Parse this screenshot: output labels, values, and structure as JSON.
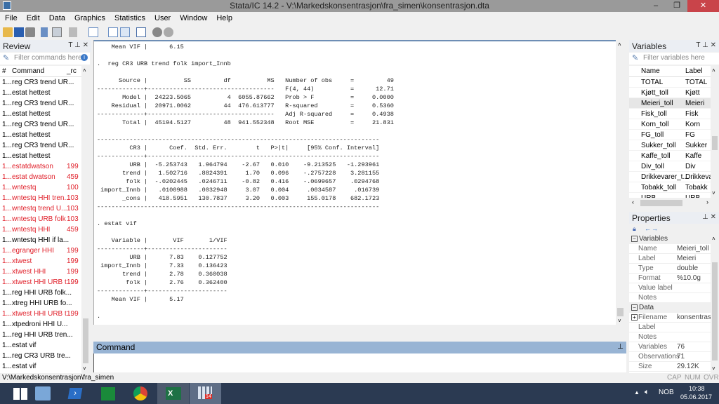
{
  "window": {
    "title": "Stata/IC 14.2 - V:\\Markedskonsentrasjon\\fra_simen\\konsentrasjon.dta",
    "minimize": "–",
    "restore": "❐",
    "close": "✕"
  },
  "menu": [
    "File",
    "Edit",
    "Data",
    "Graphics",
    "Statistics",
    "User",
    "Window",
    "Help"
  ],
  "toolbar_icons": [
    "open-icon",
    "save-icon",
    "print-icon",
    "log-icon",
    "viewer-icon",
    "graph-icon",
    "do-file-editor-icon",
    "data-editor-icon",
    "data-browser-icon",
    "variables-manager-icon",
    "more-icon",
    "break-icon"
  ],
  "review": {
    "title": "Review",
    "filter_placeholder": "Filter commands here",
    "col_num": "#",
    "col_command": "Command",
    "col_rc": "_rc",
    "items": [
      {
        "num": "1...",
        "cmd": "reg CR3 trend UR...",
        "rc": "",
        "error": false
      },
      {
        "num": "1...",
        "cmd": "estat hettest",
        "rc": "",
        "error": false
      },
      {
        "num": "1...",
        "cmd": "reg CR3 trend UR...",
        "rc": "",
        "error": false
      },
      {
        "num": "1...",
        "cmd": "estat hettest",
        "rc": "",
        "error": false
      },
      {
        "num": "1...",
        "cmd": "reg CR3 trend UR...",
        "rc": "",
        "error": false
      },
      {
        "num": "1...",
        "cmd": "estat hettest",
        "rc": "",
        "error": false
      },
      {
        "num": "1...",
        "cmd": "reg CR3 trend UR...",
        "rc": "",
        "error": false
      },
      {
        "num": "1...",
        "cmd": "estat hettest",
        "rc": "",
        "error": false
      },
      {
        "num": "1...",
        "cmd": "estatdwatson",
        "rc": "199",
        "error": true
      },
      {
        "num": "1...",
        "cmd": "estat dwatson",
        "rc": "459",
        "error": true
      },
      {
        "num": "1...",
        "cmd": "wntestq",
        "rc": "100",
        "error": true
      },
      {
        "num": "1...",
        "cmd": "wntestq HHI tren...",
        "rc": "103",
        "error": true
      },
      {
        "num": "1...",
        "cmd": " wntestq trend U...",
        "rc": "103",
        "error": true
      },
      {
        "num": "1...",
        "cmd": "wntestq URB folk",
        "rc": "103",
        "error": true
      },
      {
        "num": "1...",
        "cmd": " wntestq HHI",
        "rc": "459",
        "error": true
      },
      {
        "num": "1...",
        "cmd": "wntestq HHI if la...",
        "rc": "",
        "error": false
      },
      {
        "num": "1...",
        "cmd": "egranger HHI",
        "rc": "199",
        "error": true
      },
      {
        "num": "1...",
        "cmd": "xtwest",
        "rc": "199",
        "error": true
      },
      {
        "num": "1...",
        "cmd": "xtwest HHI",
        "rc": "199",
        "error": true
      },
      {
        "num": "1...",
        "cmd": "xtwest HHI URB t...",
        "rc": "199",
        "error": true
      },
      {
        "num": "1...",
        "cmd": "reg HHI URB folk...",
        "rc": "",
        "error": false
      },
      {
        "num": "1...",
        "cmd": "xtreg HHI URB fo...",
        "rc": "",
        "error": false
      },
      {
        "num": "1...",
        "cmd": "xtwest HHI URB t...",
        "rc": "199",
        "error": true
      },
      {
        "num": "1...",
        "cmd": "xtpedroni HHI U...",
        "rc": "",
        "error": false
      },
      {
        "num": "1...",
        "cmd": "reg HHI URB tren...",
        "rc": "",
        "error": false
      },
      {
        "num": "1...",
        "cmd": "estat vif",
        "rc": "",
        "error": false
      },
      {
        "num": "1...",
        "cmd": " reg CR3 URB tre...",
        "rc": "",
        "error": false
      },
      {
        "num": "1...",
        "cmd": "estat vif",
        "rc": "",
        "error": false
      }
    ]
  },
  "results": {
    "prev_meanvif_label": "Mean VIF",
    "prev_meanvif_value": "6.15",
    "reg_command": ".  reg CR3 URB trend folk import_Innb",
    "anova": {
      "headers": [
        "Source",
        "SS",
        "df",
        "MS"
      ],
      "rows": [
        {
          "source": "Model",
          "ss": "24223.5065",
          "df": "4",
          "ms": "6055.87662"
        },
        {
          "source": "Residual",
          "ss": "20971.0062",
          "df": "44",
          "ms": "476.613777"
        },
        {
          "source": "Total",
          "ss": "45194.5127",
          "df": "48",
          "ms": "941.552348"
        }
      ]
    },
    "stats": [
      {
        "label": "Number of obs",
        "value": "49"
      },
      {
        "label": "F(4, 44)",
        "value": "12.71"
      },
      {
        "label": "Prob > F",
        "value": "0.0000"
      },
      {
        "label": "R-squared",
        "value": "0.5360"
      },
      {
        "label": "Adj R-squared",
        "value": "0.4938"
      },
      {
        "label": "Root MSE",
        "value": "21.831"
      }
    ],
    "coef": {
      "headers": [
        "CR3",
        "Coef.",
        "Std. Err.",
        "t",
        "P>|t|",
        "[95% Conf. Interval]"
      ],
      "rows": [
        {
          "var": "URB",
          "coef": "-5.253743",
          "se": "1.964794",
          "t": "-2.67",
          "p": "0.010",
          "lo": "-9.213525",
          "hi": "-1.293961"
        },
        {
          "var": "trend",
          "coef": "1.502716",
          "se": ".8824391",
          "t": "1.70",
          "p": "0.096",
          "lo": "-.2757228",
          "hi": "3.281155"
        },
        {
          "var": "folk",
          "coef": "-.0202445",
          "se": ".0246711",
          "t": "-0.82",
          "p": "0.416",
          "lo": "-.0699657",
          "hi": ".0294768"
        },
        {
          "var": "import_Innb",
          "coef": ".0100988",
          "se": ".0032948",
          "t": "3.07",
          "p": "0.004",
          "lo": ".0034587",
          "hi": ".016739"
        },
        {
          "var": "_cons",
          "coef": "418.5951",
          "se": "130.7837",
          "t": "3.20",
          "p": "0.003",
          "lo": "155.0178",
          "hi": "682.1723"
        }
      ]
    },
    "vif_command": ". estat vif",
    "vif": {
      "headers": [
        "Variable",
        "VIF",
        "1/VIF"
      ],
      "rows": [
        {
          "var": "URB",
          "vif": "7.83",
          "inv": "0.127752"
        },
        {
          "var": "import_Innb",
          "vif": "7.33",
          "inv": "0.136423"
        },
        {
          "var": "trend",
          "vif": "2.78",
          "inv": "0.360038"
        },
        {
          "var": "folk",
          "vif": "2.76",
          "inv": "0.362400"
        }
      ],
      "mean_label": "Mean VIF",
      "mean_value": "5.17"
    },
    "prompt": "."
  },
  "command": {
    "title": "Command",
    "value": ""
  },
  "variables": {
    "title": "Variables",
    "filter_placeholder": "Filter variables here",
    "col_name": "Name",
    "col_label": "Label",
    "items": [
      {
        "name": "TOTAL",
        "label": "TOTAL"
      },
      {
        "name": "Kjøtt_toll",
        "label": "Kjøtt"
      },
      {
        "name": "Meieri_toll",
        "label": "Meieri",
        "selected": true
      },
      {
        "name": "Fisk_toll",
        "label": "Fisk"
      },
      {
        "name": "Korn_toll",
        "label": "Korn"
      },
      {
        "name": "FG_toll",
        "label": "FG"
      },
      {
        "name": "Sukker_toll",
        "label": "Sukker"
      },
      {
        "name": "Kaffe_toll",
        "label": "Kaffe"
      },
      {
        "name": "Div_toll",
        "label": "Div"
      },
      {
        "name": "Drikkevarer_t...",
        "label": "Drikkevar"
      },
      {
        "name": "Tobakk_toll",
        "label": "Tobakk"
      },
      {
        "name": "URB",
        "label": "URB"
      }
    ]
  },
  "properties": {
    "title": "Properties",
    "variables_section": "Variables",
    "variables": [
      {
        "k": "Name",
        "v": "Meieri_toll"
      },
      {
        "k": "Label",
        "v": "Meieri"
      },
      {
        "k": "Type",
        "v": "double"
      },
      {
        "k": "Format",
        "v": "%10.0g"
      },
      {
        "k": "Value label",
        "v": ""
      },
      {
        "k": "Notes",
        "v": ""
      }
    ],
    "data_section": "Data",
    "data": [
      {
        "k": "Filename",
        "v": "konsentrasjon"
      },
      {
        "k": "Label",
        "v": ""
      },
      {
        "k": "Notes",
        "v": ""
      },
      {
        "k": "Variables",
        "v": "76"
      },
      {
        "k": "Observations",
        "v": "71"
      },
      {
        "k": "Size",
        "v": "29.12K"
      }
    ]
  },
  "status": {
    "path": "V:\\Markedskonsentrasjon\\fra_simen",
    "cap": "CAP",
    "num": "NUM",
    "ovr": "OVR"
  },
  "taskbar": {
    "apps": [
      "start-button",
      "file-explorer",
      "powershell",
      "store",
      "chrome",
      "excel",
      "stata"
    ],
    "stata_badge": "14",
    "language": "NOB",
    "time": "10:38",
    "date": "05.06.2017"
  }
}
